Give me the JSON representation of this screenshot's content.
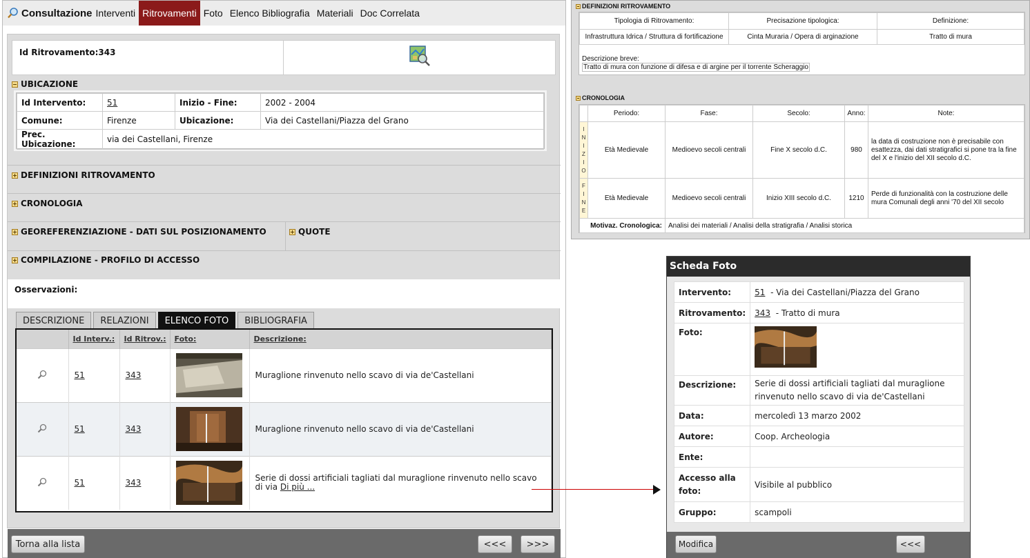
{
  "nav": {
    "logo_label": "Consultazione",
    "tabs": [
      "Interventi",
      "Ritrovamenti",
      "Foto",
      "Elenco Bibliografia",
      "Materiali",
      "Doc Correlata"
    ],
    "active_tab": "Ritrovamenti"
  },
  "record": {
    "id_label": "Id Ritrovamento:343"
  },
  "sections": {
    "ubicazione": "UBICAZIONE",
    "definizioni": "DEFINIZIONI RITROVAMENTO",
    "cronologia": "CRONOLOGIA",
    "georef": "GEOREFERENZIAZIONE - DATI SUL POSIZIONAMENTO",
    "quote": "QUOTE",
    "compilazione": "COMPILAZIONE - PROFILO DI ACCESSO"
  },
  "ubicazione": {
    "id_intervento_label": "Id Intervento:",
    "id_intervento_value": "51",
    "inizio_fine_label": "Inizio - Fine:",
    "inizio_fine_value": "2002  - 2004",
    "comune_label": "Comune:",
    "comune_value": "Firenze",
    "ubicazione_label": "Ubicazione:",
    "ubicazione_value": "Via dei Castellani/Piazza del Grano",
    "prec_label": "Prec. Ubicazione:",
    "prec_value": "via dei Castellani, Firenze"
  },
  "osservazioni_label": "Osservazioni:",
  "subtabs": [
    "DESCRIZIONE",
    "RELAZIONI",
    "ELENCO FOTO",
    "BIBLIOGRAFIA"
  ],
  "photo_grid": {
    "columns": [
      "Id Interv.:",
      "Id Ritrov.:",
      "Foto:",
      "Descrizione:"
    ],
    "rows": [
      {
        "interv": "51",
        "ritrov": "343",
        "desc": "Muraglione rinvenuto nello scavo di via de'Castellani",
        "more": ""
      },
      {
        "interv": "51",
        "ritrov": "343",
        "desc": "Muraglione rinvenuto nello scavo di via de'Castellani",
        "more": ""
      },
      {
        "interv": "51",
        "ritrov": "343",
        "desc": "Serie di dossi artificiali tagliati dal muraglione rinvenuto nello scavo di via",
        "more": "Di più ..."
      }
    ]
  },
  "footer": {
    "back_label": "Torna alla lista",
    "prev_label": "<<<",
    "next_label": ">>>"
  },
  "detail": {
    "def_title": "DEFINIZIONI RITROVAMENTO",
    "def_headers": [
      "Tipologia di Ritrovamento:",
      "Precisazione tipologica:",
      "Definizione:"
    ],
    "def_values": [
      "Infrastruttura Idrica / Struttura di fortificazione",
      "Cinta Muraria / Opera di arginazione",
      "Tratto di mura"
    ],
    "desc_breve_label": "Descrizione breve:",
    "desc_breve_value": "Tratto di mura con funzione di difesa e di argine per il torrente Scheraggio",
    "crono_title": "CRONOLOGIA",
    "crono_headers": [
      "Periodo:",
      "Fase:",
      "Secolo:",
      "Anno:",
      "Note:"
    ],
    "crono_rows": [
      {
        "tag": "INIZIO",
        "periodo": "Età Medievale",
        "fase": "Medioevo secoli centrali",
        "secolo": "Fine  X secolo d.C.",
        "anno": "980",
        "note": "la data di costruzione non è precisabile con esattezza, dai dati stratigrafici si pone tra la fine del X e l'inizio del XII secolo d.C."
      },
      {
        "tag": "FINE",
        "periodo": "Età Medievale",
        "fase": "Medioevo secoli centrali",
        "secolo": "Inizio  XIII secolo d.C.",
        "anno": "1210",
        "note": "Perde di funzionalità con la costruzione delle mura Comunali degli anni '70 del XII secolo"
      }
    ],
    "motiv_label": "Motivaz. Cronologica:",
    "motiv_value": "Analisi dei materiali / Analisi della stratigrafia / Analisi storica"
  },
  "scheda": {
    "title": "Scheda Foto",
    "intervento_label": "Intervento:",
    "intervento_id": "51",
    "intervento_rest": "- Via dei Castellani/Piazza del Grano",
    "ritrovamento_label": "Ritrovamento:",
    "ritrovamento_id": "343",
    "ritrovamento_rest": "- Tratto di mura",
    "foto_label": "Foto:",
    "descrizione_label": "Descrizione:",
    "descrizione_value": "Serie di dossi artificiali tagliati dal muraglione rinvenuto nello scavo di via de'Castellani",
    "data_label": "Data:",
    "data_value": "mercoledì 13 marzo 2002",
    "autore_label": "Autore:",
    "autore_value": "Coop. Archeologia",
    "ente_label": "Ente:",
    "ente_value": "",
    "accesso_label": "Accesso alla foto:",
    "accesso_value": "Visibile al pubblico",
    "gruppo_label": "Gruppo:",
    "gruppo_value": "scampoli",
    "modifica_label": "Modifica",
    "back_label": "<<<"
  }
}
